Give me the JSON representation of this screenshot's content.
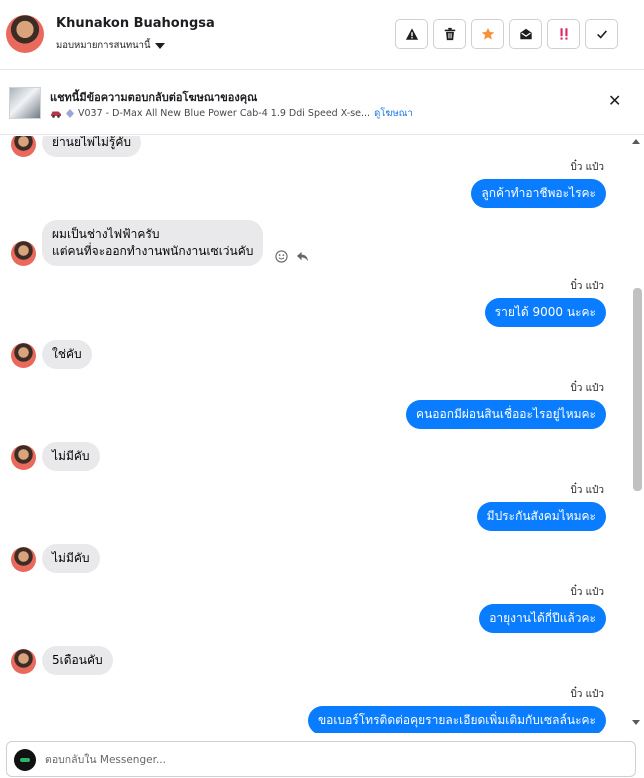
{
  "header": {
    "contact_name": "Khunakon Buahongsa",
    "assign_label": "มอบหมายการสนทนานี้"
  },
  "ad": {
    "title": "แชทนี้มีข้อความตอบกลับต่อโฆษณาของคุณ",
    "subtitle": "V037 - D-Max All New Blue Power Cab-4 1.9 Ddi Speed X-se...",
    "link": "ดูโฆษณา"
  },
  "messages": {
    "m0": {
      "text": "ย่านยไพ่ไม่รู้คับ"
    },
    "m1": {
      "sender": "บิ๋ว แป๋ว",
      "text": "ลูกค้าทำอาชีพอะไรคะ"
    },
    "m2": {
      "line1": "ผมเป็นช่างไฟฟ้าครับ",
      "line2": "แต่คนที่จะออกทำงานพนักงานเซเว่นคับ"
    },
    "m3": {
      "sender": "บิ๋ว แป๋ว",
      "text": "รายได้ 9000  นะคะ"
    },
    "m4": {
      "text": "ใช่คับ"
    },
    "m5": {
      "sender": "บิ๋ว แป๋ว",
      "text": "คนออกมีผ่อนสินเชื่ออะไรอยู่ไหมคะ"
    },
    "m6": {
      "text": "ไม่มีคับ"
    },
    "m7": {
      "sender": "บิ๋ว แป๋ว",
      "text": "มีประกันสังคมไหมคะ"
    },
    "m8": {
      "text": "ไม่มีคับ"
    },
    "m9": {
      "sender": "บิ๋ว แป๋ว",
      "text": "อายุงานได้กี่ปีแล้วคะ"
    },
    "m10": {
      "text": "5เดือนคับ"
    },
    "m11": {
      "sender": "บิ๋ว แป๋ว",
      "text": "ขอเบอร์โทรติดต่อคุยรายละเอียดเพิ่มเติมกับเซลล์นะคะ"
    }
  },
  "composer": {
    "placeholder": "ตอบกลับใน Messenger..."
  },
  "icons": {
    "actions": [
      "warning-icon",
      "trash-icon",
      "star-icon",
      "envelope-open-icon",
      "priority-icon",
      "check-icon"
    ]
  },
  "colors": {
    "outgoing_bubble": "#0a7cff",
    "incoming_bubble": "#e9e9eb",
    "star": "#f7923a",
    "priority": "#e0245e",
    "link": "#1b74e4"
  }
}
